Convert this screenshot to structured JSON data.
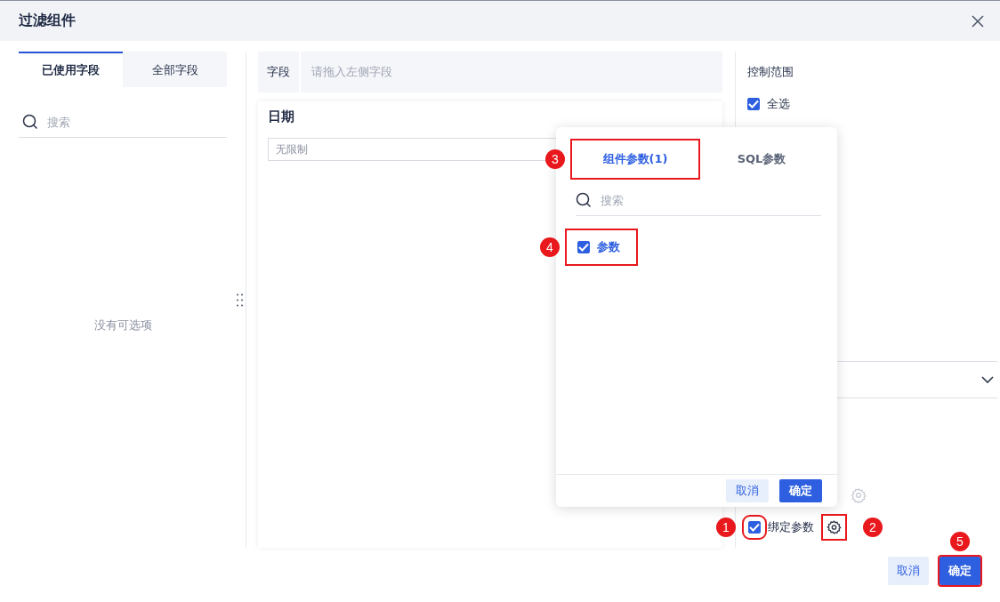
{
  "dialog": {
    "title": "过滤组件"
  },
  "field_tabs": [
    {
      "label": "已使用字段",
      "selected": true
    },
    {
      "label": "全部字段",
      "selected": false
    }
  ],
  "field_search": {
    "placeholder": "搜索"
  },
  "empty_text": "没有可选项",
  "field_drop": {
    "label": "字段",
    "placeholder": "请拖入左侧字段"
  },
  "filter": {
    "title": "日期",
    "select_placeholder": "无限制"
  },
  "control_scope": {
    "title": "控制范围",
    "select_all": {
      "label": "全选",
      "checked": true
    }
  },
  "bind_param": {
    "label": "绑定参数",
    "checked": true,
    "marker": "1",
    "gear_marker": "2"
  },
  "popup": {
    "tabs": [
      {
        "label": "组件参数(1)",
        "selected": true,
        "marker": "3"
      },
      {
        "label": "SQL参数",
        "selected": false
      }
    ],
    "search": {
      "placeholder": "搜索"
    },
    "items": [
      {
        "label": "参数",
        "checked": true,
        "marker": "4"
      }
    ],
    "buttons": [
      {
        "label": "取消",
        "kind": "secondary"
      },
      {
        "label": "确定",
        "kind": "primary"
      }
    ]
  },
  "buttons": [
    {
      "label": "取消",
      "kind": "secondary"
    },
    {
      "label": "确定",
      "kind": "primary",
      "marker": "5"
    }
  ]
}
